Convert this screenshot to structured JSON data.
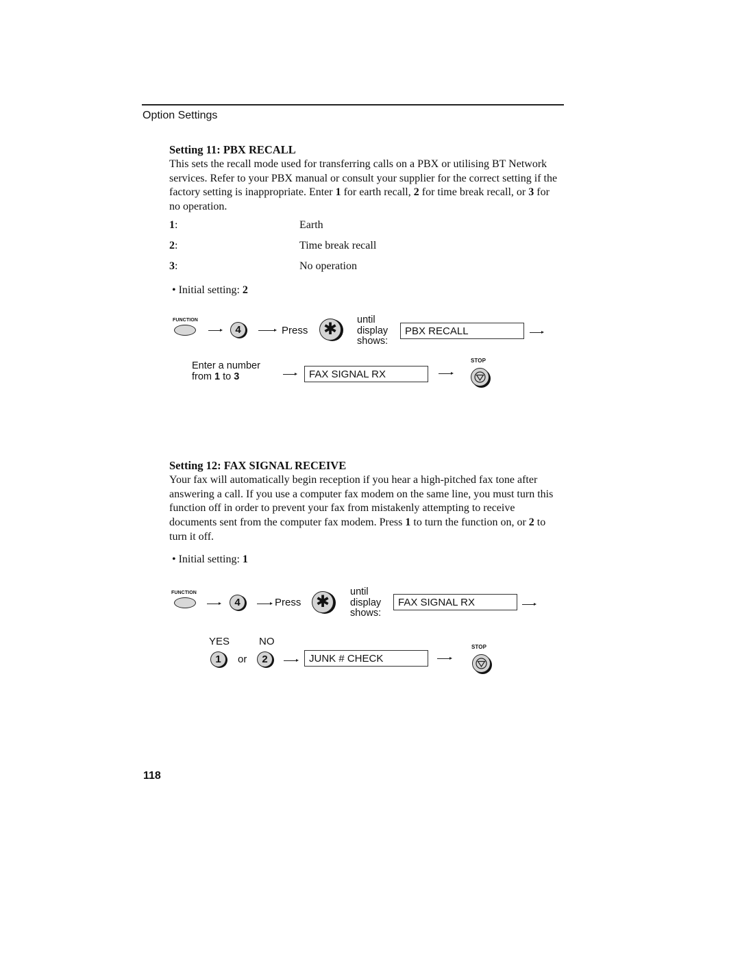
{
  "header": {
    "section_title": "Option Settings"
  },
  "setting11": {
    "heading": "Setting 11: PBX RECALL",
    "paragraph": [
      {
        "t": "This sets the recall mode used for transferring calls on a PBX or utilising BT Network services. Refer to your PBX manual or consult your supplier for the correct setting if the factory setting is inappropriate. Enter ",
        "b": false
      },
      {
        "t": "1",
        "b": true
      },
      {
        "t": " for earth recall, ",
        "b": false
      },
      {
        "t": "2",
        "b": true
      },
      {
        "t": " for time break recall, or ",
        "b": false
      },
      {
        "t": "3",
        "b": true
      },
      {
        "t": " for no operation.",
        "b": false
      }
    ],
    "options": [
      {
        "num": "1",
        "label": "Earth"
      },
      {
        "num": "2",
        "label": "Time break recall"
      },
      {
        "num": "3",
        "label": "No operation"
      }
    ],
    "initial_label": "• Initial setting: ",
    "initial_value": "2",
    "diagram": {
      "function_label": "FUNCTION",
      "key_4": "4",
      "press_label": "Press",
      "star_key": "✱",
      "until_lines": [
        "until",
        "display",
        "shows:"
      ],
      "display_1": "PBX RECALL",
      "enter_line1": "Enter a number",
      "enter_line2_pre": "from ",
      "enter_from": "1",
      "enter_mid": " to ",
      "enter_to": "3",
      "display_2": "FAX SIGNAL RX",
      "stop_label": "STOP"
    }
  },
  "setting12": {
    "heading": "Setting 12: FAX SIGNAL RECEIVE",
    "paragraph": [
      {
        "t": "Your fax will automatically begin reception if you hear a high-pitched fax tone after answering a call. If you use a computer fax modem on the same line, you must turn this function off in order to prevent your fax from mistakenly attempting to receive documents sent from the computer fax modem. Press ",
        "b": false
      },
      {
        "t": "1",
        "b": true
      },
      {
        "t": " to turn the function on, or ",
        "b": false
      },
      {
        "t": "2",
        "b": true
      },
      {
        "t": " to turn it off.",
        "b": false
      }
    ],
    "initial_label": "• Initial setting: ",
    "initial_value": "1",
    "diagram": {
      "function_label": "FUNCTION",
      "key_4": "4",
      "press_label": "Press",
      "star_key": "✱",
      "until_lines": [
        "until",
        "display",
        "shows:"
      ],
      "display_1": "FAX SIGNAL RX",
      "yes_label": "YES",
      "no_label": "NO",
      "key_1": "1",
      "or_label": "or",
      "key_2": "2",
      "display_2": "JUNK # CHECK",
      "stop_label": "STOP"
    }
  },
  "footer": {
    "page_number": "118"
  }
}
